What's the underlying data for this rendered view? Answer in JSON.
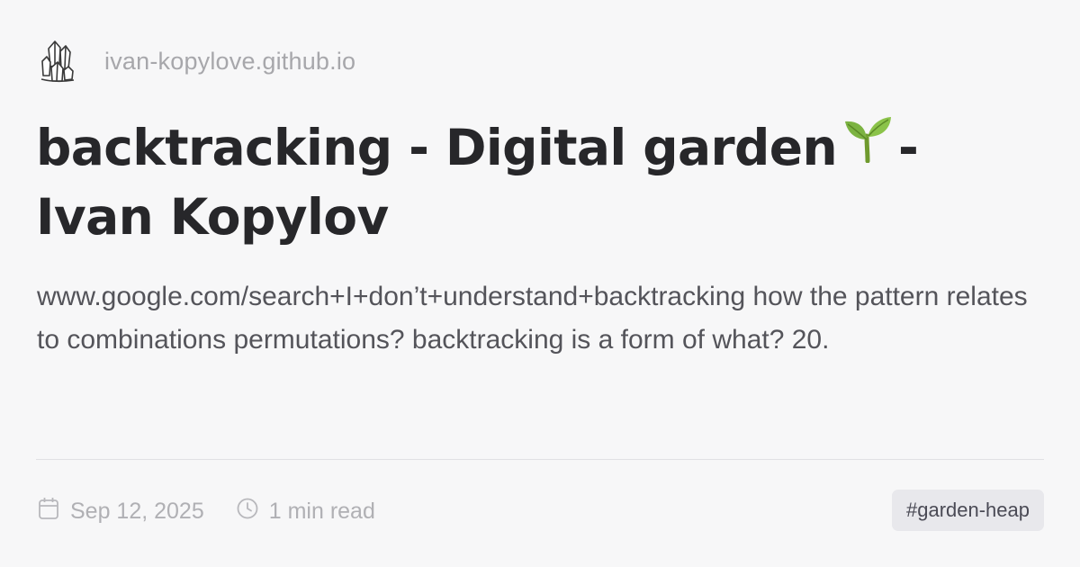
{
  "site": {
    "logo_icon": "crystal-icon",
    "domain": "ivan-kopylove.github.io"
  },
  "article": {
    "title_before_icon": "backtracking - Digital garden",
    "title_icon": "seedling-icon",
    "title_after_icon": "- Ivan Kopylov",
    "excerpt": "www.google.com/search+I+don’t+understand+backtracking how the pattern relates to combinations permutations? backtracking is a form of what? 20."
  },
  "meta": {
    "date_icon": "calendar-icon",
    "date": "Sep 12, 2025",
    "read_time_icon": "clock-icon",
    "read_time": "1 min read"
  },
  "tag": {
    "label": "#garden-heap"
  },
  "colors": {
    "background": "#f7f7f8",
    "title": "#27272a",
    "muted": "#a7a7ab",
    "seedling_leaf": "#7cb342",
    "tag_background": "#e8e8ec"
  }
}
